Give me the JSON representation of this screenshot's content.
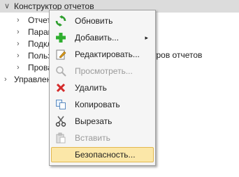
{
  "tree": {
    "root": {
      "arrow": "∨",
      "label": "Конструктор отчетов"
    },
    "children": [
      {
        "arrow": "›",
        "label": "Отчет"
      },
      {
        "arrow": "›",
        "label": "Парам"
      },
      {
        "arrow": "›",
        "label": "Подкл"
      },
      {
        "arrow": "›",
        "label": "Польз"
      },
      {
        "arrow": "›",
        "label": "Прова"
      }
    ],
    "top_sibling": {
      "arrow": "›",
      "label": "Управлен"
    },
    "obscured_tail": "тров отчетов"
  },
  "context_menu": {
    "items": [
      {
        "label": "Обновить",
        "icon": "refresh-icon",
        "disabled": false
      },
      {
        "label": "Добавить...",
        "icon": "add-icon",
        "disabled": false,
        "submenu": "▸"
      },
      {
        "label": "Редактировать...",
        "icon": "edit-icon",
        "disabled": false
      },
      {
        "label": "Просмотреть...",
        "icon": "view-icon",
        "disabled": true
      },
      {
        "label": "Удалить",
        "icon": "delete-icon",
        "disabled": false
      },
      {
        "label": "Копировать",
        "icon": "copy-icon",
        "disabled": false
      },
      {
        "label": "Вырезать",
        "icon": "cut-icon",
        "disabled": false
      },
      {
        "label": "Вставить",
        "icon": "paste-icon",
        "disabled": true
      },
      {
        "label": "Безопасность...",
        "icon": "",
        "disabled": false,
        "highlighted": true
      }
    ]
  },
  "colors": {
    "selection_bg": "#dcdcdc",
    "menu_highlight_bg": "#fbe7a8",
    "menu_highlight_border": "#e2b84f",
    "refresh_green": "#2e9e2e",
    "add_green": "#2fae2f",
    "delete_red": "#d42a2a",
    "disabled_text": "#9a9a9a"
  }
}
